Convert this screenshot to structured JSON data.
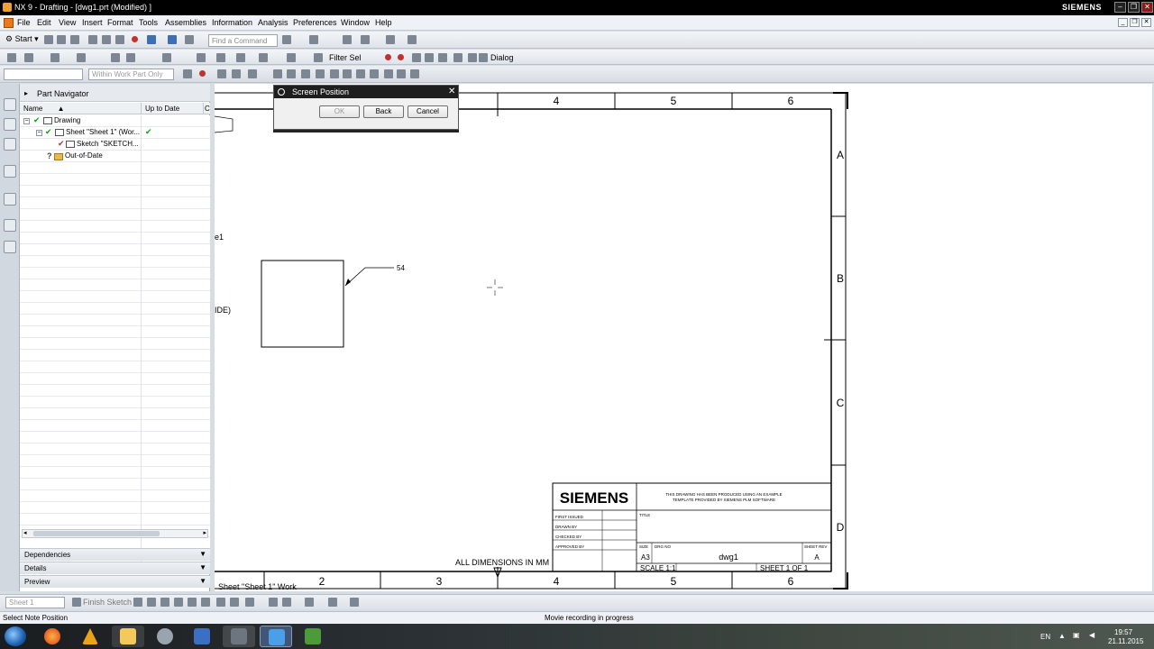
{
  "window": {
    "title": "NX 9 - Drafting - [dwg1.prt (Modified) ]",
    "brand": "SIEMENS"
  },
  "menu": [
    "File",
    "Edit",
    "View",
    "Insert",
    "Format",
    "Tools",
    "Assemblies",
    "Information",
    "Analysis",
    "Preferences",
    "Window",
    "Help"
  ],
  "toolbar": {
    "start_label": "Start",
    "find_placeholder": "Find a Command",
    "selection_scope": "Within Work Part Only",
    "filter_label": "Filter Sel",
    "dialog_label": "Dialog"
  },
  "navigator": {
    "title": "Part Navigator",
    "col_name": "Name",
    "col_uptodate": "Up to Date",
    "col_extra": "C",
    "nodes": [
      {
        "label": "Drawing"
      },
      {
        "label": "Sheet \"Sheet 1\" (Wor..."
      },
      {
        "label": "Sketch \"SKETCH..."
      },
      {
        "label": "Out-of-Date"
      }
    ],
    "panels": [
      "Dependencies",
      "Details",
      "Preview"
    ]
  },
  "dialog": {
    "title": "Screen Position",
    "ok": "OK",
    "back": "Back",
    "cancel": "Cancel"
  },
  "drawing": {
    "top_zones": [
      "4",
      "5",
      "6"
    ],
    "bottom_zones": [
      "2",
      "3",
      "4",
      "5",
      "6"
    ],
    "right_zones": [
      "A",
      "B",
      "C",
      "D"
    ],
    "left_cut_text_1": "e1",
    "left_cut_text_2": "IDE)",
    "callout_value": "54",
    "dimensions_note": "ALL DIMENSIONS IN MM",
    "sheet_tab": "Sheet \"Sheet 1\" Work",
    "title_block": {
      "logo": "SIEMENS",
      "note_line1": "THIS DRAWING HAS BEEN PRODUCED USING AN EXAMPLE",
      "note_line2": "TEMPLATE PROVIDED BY SIEMENS PLM SOFTWARE",
      "first_issued": "FIRST ISSUED",
      "drawn_by": "DRAWN BY",
      "checked_by": "CHECKED BY",
      "approved_by": "APPROVED BY",
      "title_label": "TITLE",
      "size_label": "SIZE",
      "size_value": "A3",
      "dwg_no_label": "DRG NO",
      "dwg_no_value": "dwg1",
      "rev_label": "SHEET REV",
      "rev_value": "A",
      "scale": "SCALE 1:1",
      "sheet": "SHEET 1 OF 1"
    }
  },
  "sketchbar": {
    "sheet_combo": "Sheet 1",
    "finish_label": "Finish Sketch"
  },
  "status": {
    "left": "Select Note Position",
    "center": "Movie recording in progress"
  },
  "taskbar": {
    "lang": "EN",
    "time": "19:57",
    "date": "21.11.2015"
  },
  "colors": {
    "title_bar": "#000000",
    "check_green": "#1a9a1a",
    "accent_blue": "#3d6fb5"
  }
}
